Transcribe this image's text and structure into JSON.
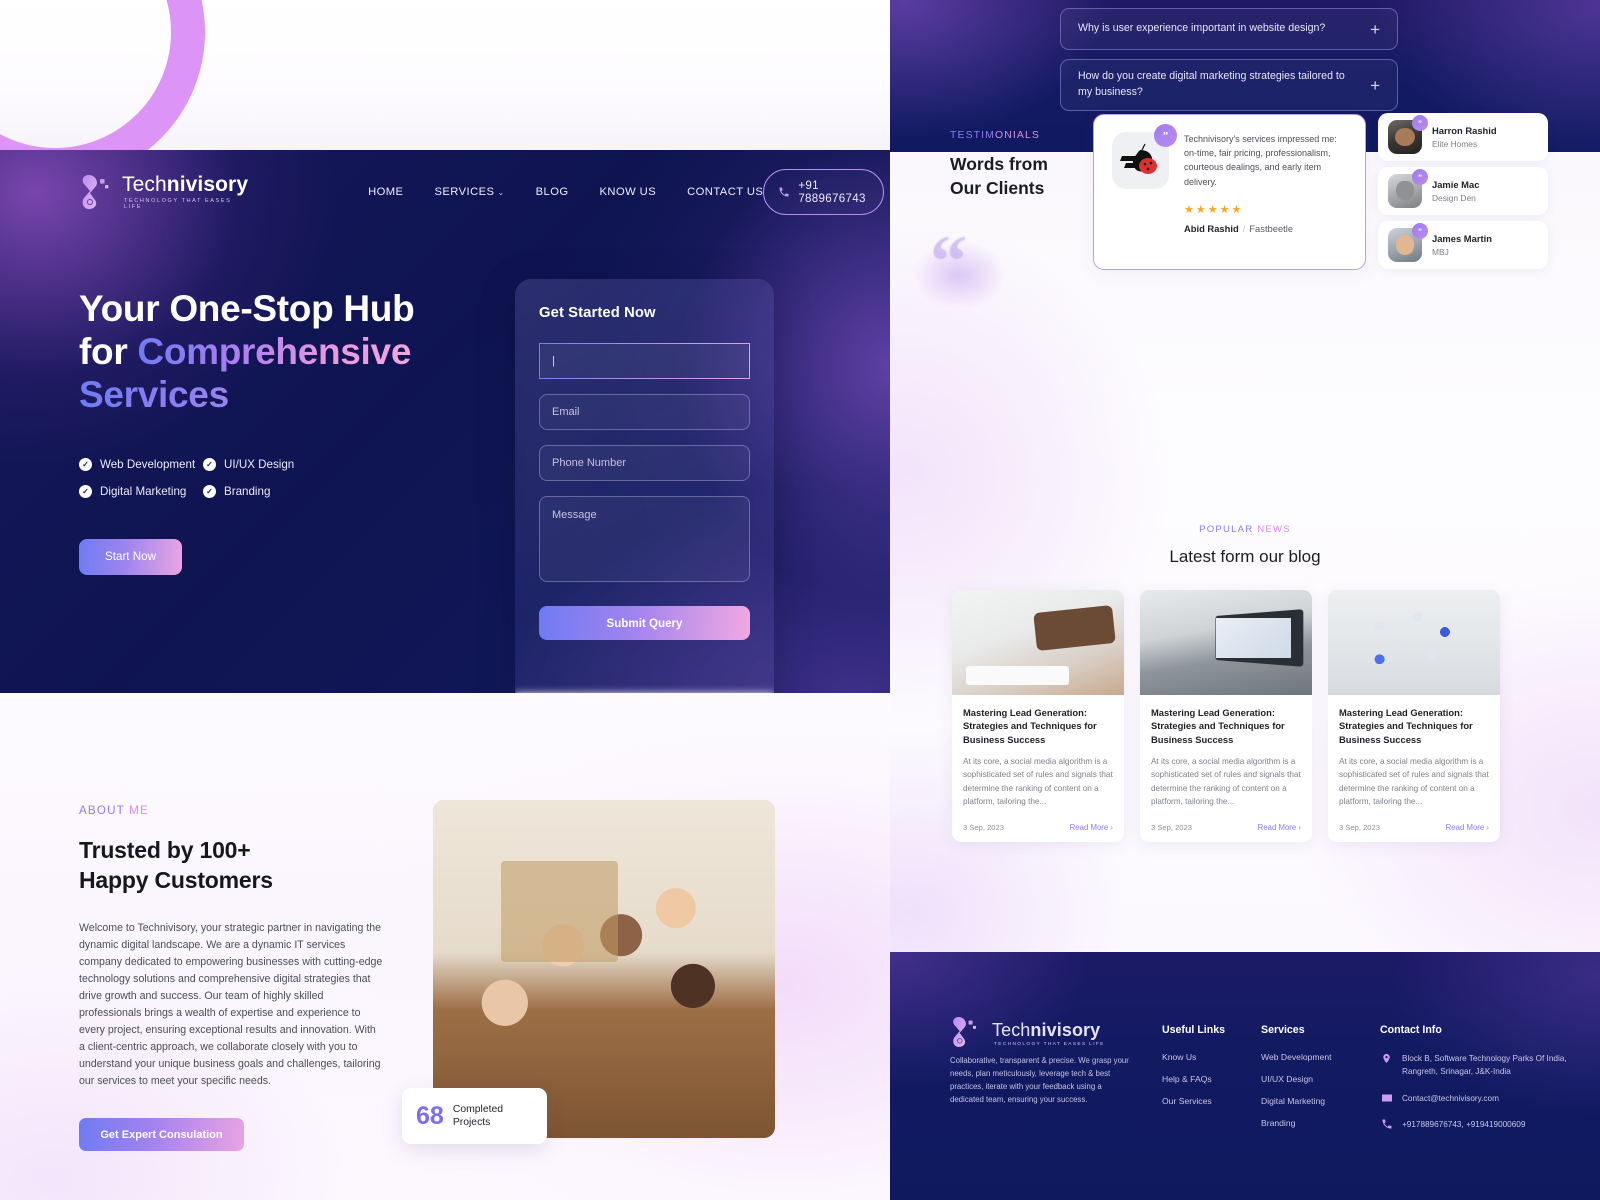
{
  "brand": {
    "name_light": "Tech",
    "name_bold": "nivisory",
    "tagline": "TECHNOLOGY THAT EASES LIFE",
    "accent": "#8d7df0",
    "accent_pink": "#d68fe2"
  },
  "nav": {
    "links": [
      {
        "label": "HOME"
      },
      {
        "label": "SERVICES",
        "caret": "⌄"
      },
      {
        "label": "BLOG"
      },
      {
        "label": "KNOW US"
      },
      {
        "label": "CONTACT US"
      }
    ],
    "phone_button": "+91 7889676743",
    "phone_icon": "phone-icon"
  },
  "hero": {
    "title_line1": "Your One-Stop Hub",
    "title_line2_plain": "for ",
    "title_line2_grad": "Comprehensive",
    "title_line3_grad": "Services",
    "features": [
      {
        "label": "Web Development"
      },
      {
        "label": "UI/UX Design"
      },
      {
        "label": "Digital Marketing"
      },
      {
        "label": "Branding"
      }
    ],
    "check_glyph": "✓",
    "cta": "Start Now"
  },
  "form": {
    "title": "Get Started Now",
    "name_value": "|",
    "name_placeholder": "",
    "email_placeholder": "Email",
    "phone_placeholder": "Phone Number",
    "message_placeholder": "Message",
    "submit": "Submit Query"
  },
  "about": {
    "eyebrow_a": "ABOUT",
    "eyebrow_b": "ME",
    "heading_l1": "Trusted by 100+",
    "heading_l2": "Happy Customers",
    "paragraph": "Welcome to Technivisory, your strategic partner in navigating the dynamic digital landscape. We are a dynamic IT services company dedicated to empowering businesses with cutting-edge technology solutions and comprehensive digital strategies that drive growth and success. Our team of highly skilled professionals brings a wealth of expertise and experience to every project, ensuring exceptional results and innovation. With a client-centric approach, we collaborate closely with you to understand your unique business goals and challenges, tailoring our services to meet your specific needs.",
    "cta": "Get Expert Consulation",
    "badge_number": "68",
    "badge_label_l1": "Completed",
    "badge_label_l2": "Projects",
    "badge_number_color": "#7b6ef0"
  },
  "faq": {
    "items": [
      {
        "question": "Why is user experience important in website design?",
        "toggle": "+"
      },
      {
        "question": "How do you create digital marketing strategies tailored to my business?",
        "toggle": "+"
      }
    ]
  },
  "testimonials": {
    "eyebrow_a": "TESTIM",
    "eyebrow_b": "ONIALS",
    "heading_l1": "Words from",
    "heading_l2": "Our Clients",
    "quote_glyph": "“",
    "featured": {
      "logo_name": "fastbeetle-logo",
      "badge_glyph": "”",
      "text": "Technivisory's services impressed me: on-time, fair pricing, professionalism, courteous dealings, and early item delivery.",
      "rating": 5,
      "star_glyph": "★",
      "star_color": "#f5a623",
      "author": "Abid Rashid",
      "separator": "/",
      "company": "Fastbeetle"
    },
    "authors": [
      {
        "name": "Harron Rashid",
        "role": "Elite Homes",
        "badge": "”"
      },
      {
        "name": "Jamie Mac",
        "role": "Design Den",
        "badge": "”"
      },
      {
        "name": "James Martin",
        "role": "MBJ",
        "badge": "”"
      }
    ]
  },
  "blog": {
    "eyebrow_a": "POPULAR",
    "eyebrow_b": "NEWS",
    "heading": "Latest form our blog",
    "cards": [
      {
        "image": "hands-on-keyboard-photo",
        "title": "Mastering Lead Generation: Strategies and Techniques for Business Success",
        "excerpt": "At its core, a social media algorithm is a sophisticated set of rules and signals that determine the ranking of content on a platform, tailoring the...",
        "date": "3 Sep, 2023",
        "read_more": "Read More ›"
      },
      {
        "image": "laptop-dashboard-photo",
        "title": "Mastering Lead Generation: Strategies and Techniques for Business Success",
        "excerpt": "At its core, a social media algorithm is a sophisticated set of rules and signals that determine the ranking of content on a platform, tailoring the...",
        "date": "3 Sep, 2023",
        "read_more": "Read More ›"
      },
      {
        "image": "social-icons-photo",
        "title": "Mastering Lead Generation: Strategies and Techniques for Business Success",
        "excerpt": "At its core, a social media algorithm is a sophisticated set of rules and signals that determine the ranking of content on a platform, tailoring the...",
        "date": "3 Sep, 2023",
        "read_more": "Read More ›"
      }
    ]
  },
  "footer": {
    "description": "Collaborative, transparent & precise. We grasp your needs, plan meticulously, leverage tech & best practices, iterate with your feedback using a dedicated team, ensuring your success.",
    "useful_links": {
      "heading": "Useful Links",
      "items": [
        {
          "label": "Know Us"
        },
        {
          "label": "Help & FAQs"
        },
        {
          "label": "Our Services"
        }
      ]
    },
    "services": {
      "heading": "Services",
      "items": [
        {
          "label": "Web Development"
        },
        {
          "label": "UI/UX Design"
        },
        {
          "label": "Digital Marketing"
        },
        {
          "label": "Branding"
        }
      ]
    },
    "contact": {
      "heading": "Contact Info",
      "address": "Block B, Software Technology Parks Of India, Rangreth, Srinagar, J&K-India",
      "email": "Contact@technivisory.com",
      "phones": "+917889676743, +919419000609",
      "address_icon": "location-pin-icon",
      "email_icon": "envelope-icon",
      "phone_icon": "phone-icon"
    }
  }
}
